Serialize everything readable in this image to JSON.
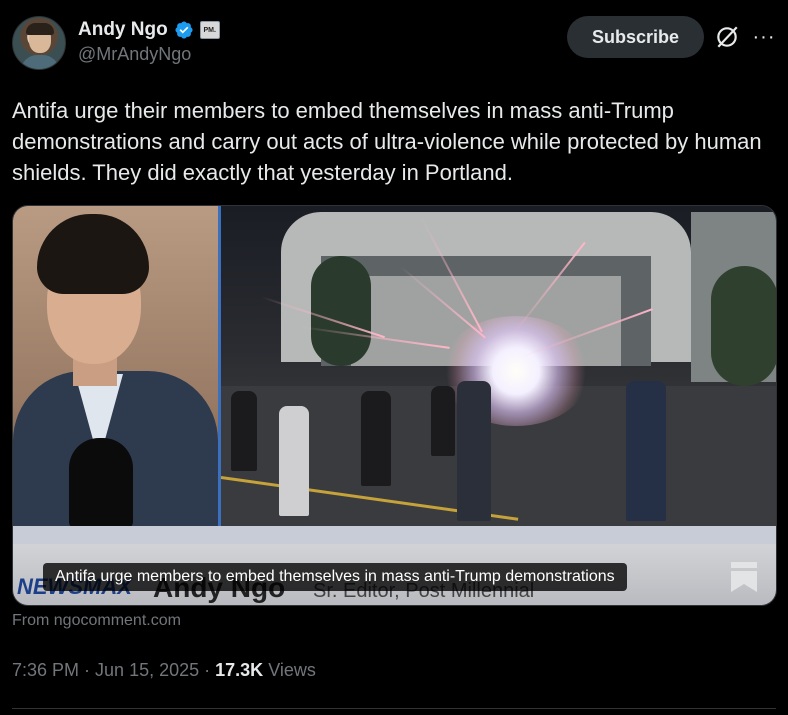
{
  "author": {
    "display_name": "Andy Ngo",
    "handle": "@MrAndyNgo",
    "affiliate_badge": "PM."
  },
  "header": {
    "subscribe_label": "Subscribe"
  },
  "tweet": {
    "text": "Antifa urge their members to embed themselves in mass anti-Trump demonstrations and carry out acts of ultra-violence while protected by human shields. They did exactly that yesterday in Portland."
  },
  "media": {
    "caption": "Antifa urge members to embed themselves in mass anti-Trump demonstrations",
    "lower_third_network": "NEWSMAX",
    "lower_third_name": "Andy Ngo",
    "lower_third_title": "Sr. Editor, Post Millennial",
    "source": "From ngocomment.com"
  },
  "meta": {
    "time": "7:36 PM",
    "separator": " · ",
    "date": "Jun 15, 2025",
    "views_count": "17.3K",
    "views_label": " Views"
  },
  "colors": {
    "verified": "#1d9bf0",
    "background": "#000000",
    "text": "#e7e9ea",
    "muted": "#71767b"
  }
}
